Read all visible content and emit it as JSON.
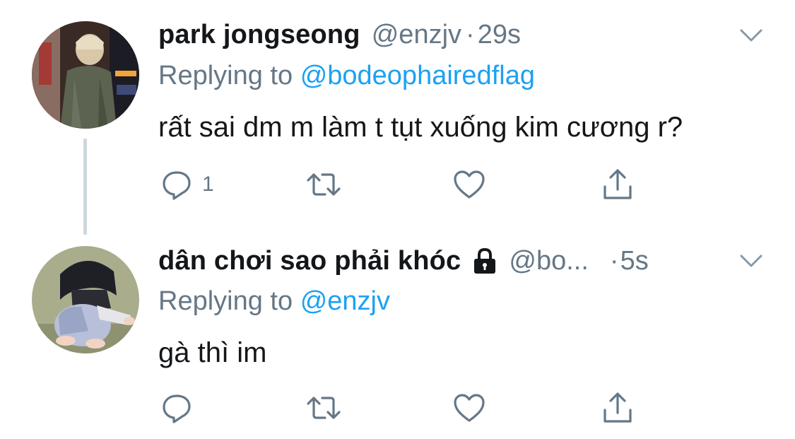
{
  "tweets": [
    {
      "display_name": "park jongseong",
      "handle": "@enzjv",
      "separator": "·",
      "time": "29s",
      "replying_prefix": "Replying to",
      "replying_to": "@bodeophairedflag",
      "text": "rất sai dm m làm t tụt xuống kim cương r?",
      "reply_count": "1",
      "protected": false,
      "icons": [
        "chevron-down-icon",
        "reply-icon",
        "retweet-icon",
        "like-icon",
        "share-icon"
      ]
    },
    {
      "display_name": "dân chơi sao phải khóc",
      "handle": "@bo...",
      "separator": "·",
      "time": "5s",
      "replying_prefix": "Replying to",
      "replying_to": "@enzjv",
      "text": "gà thì im",
      "reply_count": "",
      "protected": true,
      "icons": [
        "lock-icon",
        "chevron-down-icon",
        "reply-icon",
        "retweet-icon",
        "like-icon",
        "share-icon"
      ]
    }
  ],
  "colors": {
    "text_primary": "#14171a",
    "text_secondary": "#657786",
    "link": "#1da1f2",
    "thread_line": "#ccd6dd",
    "background": "#ffffff"
  }
}
